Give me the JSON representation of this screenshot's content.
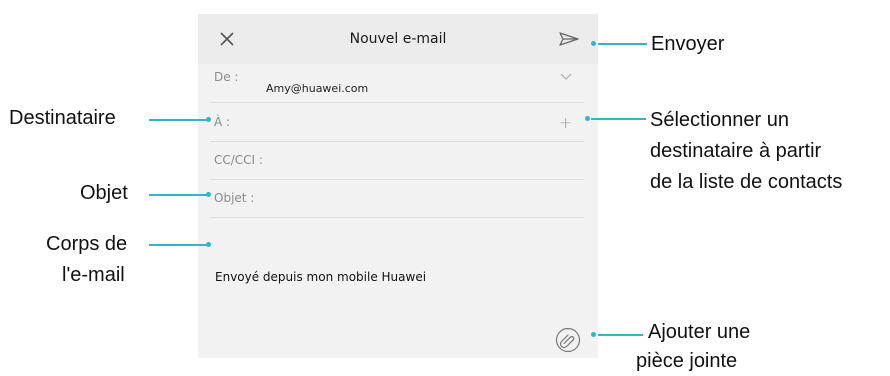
{
  "compose": {
    "title": "Nouvel e-mail",
    "from_label": "De :",
    "from_value": "Amy@huawei.com",
    "to_label": "À :",
    "plus": "+",
    "cc_label": "CC/CCI :",
    "subject_label": "Objet :",
    "signature": "Envoyé depuis mon mobile Huawei"
  },
  "callouts": {
    "send": "Envoyer",
    "recipient": "Destinataire",
    "select_contact_l1": "Sélectionner un",
    "select_contact_l2": "destinataire à partir",
    "select_contact_l3": "de la liste de contacts",
    "subject": "Objet",
    "body_l1": "Corps de",
    "body_l2": "l'e-mail",
    "attach_l1": "Ajouter une",
    "attach_l2": "pièce jointe"
  },
  "colors": {
    "leader": "#38b2c4",
    "screen_bg": "#f2f2f2",
    "topbar_bg": "#ececec"
  },
  "icons": [
    "close-icon",
    "send-icon",
    "chevron-down-icon",
    "plus-icon",
    "paperclip-icon"
  ]
}
